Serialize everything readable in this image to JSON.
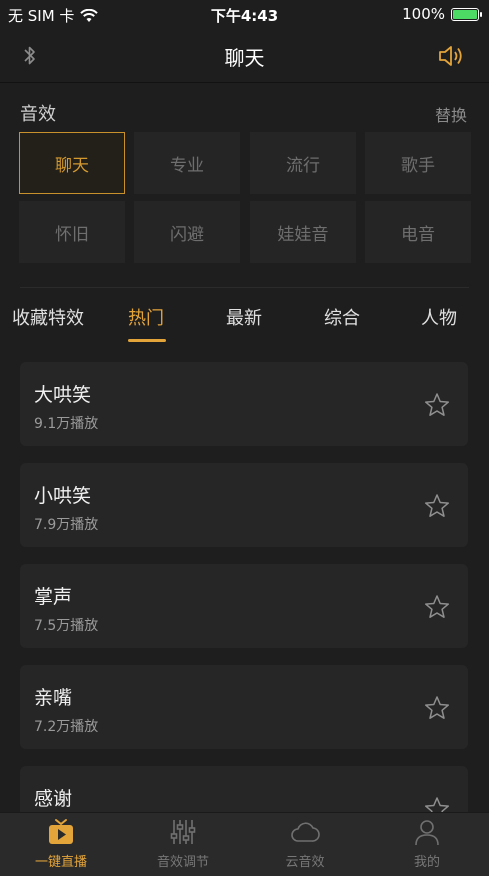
{
  "status_bar": {
    "carrier": "无 SIM 卡",
    "time": "下午4:43",
    "battery_percent": "100%",
    "battery_level": 1.0
  },
  "nav": {
    "title": "聊天",
    "left_icon": "bluetooth-icon",
    "right_icon": "speaker-icon"
  },
  "effects": {
    "title": "音效",
    "replace_label": "替换",
    "items": [
      {
        "label": "聊天",
        "selected": true
      },
      {
        "label": "专业",
        "selected": false
      },
      {
        "label": "流行",
        "selected": false
      },
      {
        "label": "歌手",
        "selected": false
      },
      {
        "label": "怀旧",
        "selected": false
      },
      {
        "label": "闪避",
        "selected": false
      },
      {
        "label": "娃娃音",
        "selected": false
      },
      {
        "label": "电音",
        "selected": false
      }
    ]
  },
  "tabs": [
    {
      "label": "收藏特效",
      "active": false
    },
    {
      "label": "热门",
      "active": true
    },
    {
      "label": "最新",
      "active": false
    },
    {
      "label": "综合",
      "active": false
    },
    {
      "label": "人物",
      "active": false
    }
  ],
  "list": [
    {
      "title": "大哄笑",
      "plays": "9.1万播放"
    },
    {
      "title": "小哄笑",
      "plays": "7.9万播放"
    },
    {
      "title": "掌声",
      "plays": "7.5万播放"
    },
    {
      "title": "亲嘴",
      "plays": "7.2万播放"
    },
    {
      "title": "感谢",
      "plays": ""
    }
  ],
  "tab_bar": [
    {
      "label": "一键直播",
      "icon": "live-play-icon",
      "active": true
    },
    {
      "label": "音效调节",
      "icon": "equalizer-icon",
      "active": false
    },
    {
      "label": "云音效",
      "icon": "cloud-icon",
      "active": false
    },
    {
      "label": "我的",
      "icon": "user-icon",
      "active": false
    }
  ],
  "colors": {
    "accent": "#e3a43a",
    "background": "#1e1e1f",
    "card": "#262627"
  }
}
